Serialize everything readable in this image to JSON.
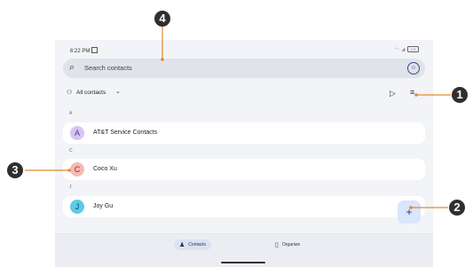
{
  "status_bar": {
    "time": "6:22 PM",
    "battery": "100"
  },
  "search": {
    "placeholder": "Search contacts"
  },
  "filter": {
    "label": "All contacts"
  },
  "sections": [
    {
      "letter": "A",
      "name": "AT&T Service Contacts",
      "initial": "A",
      "avatar_color": "#d7c4f3",
      "text_color": "#5b3c8c"
    },
    {
      "letter": "C",
      "name": "Coco Xu",
      "initial": "C",
      "avatar_color": "#f6b8b3",
      "text_color": "#8c2f2a"
    },
    {
      "letter": "J",
      "name": "Joy Gu",
      "initial": "J",
      "avatar_color": "#5ec9e8",
      "text_color": "#0d4459"
    }
  ],
  "fab": {
    "label": "+"
  },
  "bottom_nav": [
    {
      "label": "Contacts",
      "active": true
    },
    {
      "label": "Organize",
      "active": false
    }
  ],
  "callouts": [
    "1",
    "2",
    "3",
    "4"
  ],
  "colors": {
    "screen_bg": "#f3f4f8",
    "search_bg": "#e1e3eb",
    "fab_bg": "#d9e6fb",
    "callout_line": "#e08a2e",
    "callout_bg": "#2f2f2f"
  }
}
